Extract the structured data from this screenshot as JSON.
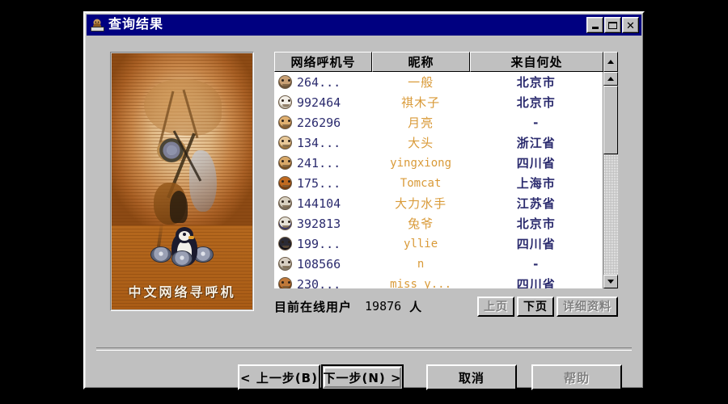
{
  "window": {
    "title": "查询结果",
    "title_icon": "pager-user-icon",
    "buttons": {
      "minimize": "minimize-icon",
      "maximize": "maximize-icon",
      "close": "✕"
    }
  },
  "promo_panel": {
    "caption": "中文网络寻呼机",
    "artwork": "penguin-with-disks-illustration"
  },
  "list": {
    "columns": [
      "网络呼机号",
      "昵称",
      "来自何处"
    ],
    "rows": [
      {
        "avatar": "avatar-face-1",
        "id": "264...",
        "nick": "一般",
        "nick_mono": false,
        "loc": "北京市"
      },
      {
        "avatar": "avatar-face-2",
        "id": "992464",
        "nick": "祺木子",
        "nick_mono": false,
        "loc": "北京市"
      },
      {
        "avatar": "avatar-face-3",
        "id": "226296",
        "nick": "月亮",
        "nick_mono": false,
        "loc": "-"
      },
      {
        "avatar": "avatar-face-4",
        "id": "134...",
        "nick": "大头",
        "nick_mono": false,
        "loc": "浙江省"
      },
      {
        "avatar": "avatar-face-5",
        "id": "241...",
        "nick": "yingxiong",
        "nick_mono": true,
        "loc": "四川省"
      },
      {
        "avatar": "avatar-face-6",
        "id": "175...",
        "nick": "Tomcat",
        "nick_mono": true,
        "loc": "上海市"
      },
      {
        "avatar": "avatar-face-7",
        "id": "144104",
        "nick": "大力水手",
        "nick_mono": false,
        "loc": "江苏省"
      },
      {
        "avatar": "avatar-face-8",
        "id": "392813",
        "nick": "兔爷",
        "nick_mono": false,
        "loc": "北京市"
      },
      {
        "avatar": "avatar-face-9",
        "id": "199...",
        "nick": "yllie",
        "nick_mono": true,
        "loc": "四川省"
      },
      {
        "avatar": "avatar-face-10",
        "id": "108566",
        "nick": "n",
        "nick_mono": true,
        "loc": "-"
      },
      {
        "avatar": "avatar-face-11",
        "id": "230...",
        "nick": "miss y...",
        "nick_mono": true,
        "loc": "四川省"
      }
    ]
  },
  "scrollbar": {
    "up_arrow": "scroll-up-icon",
    "down_arrow": "scroll-down-icon"
  },
  "status": {
    "label": "目前在线用户",
    "count": "19876",
    "unit": "人",
    "prev_page": "上页",
    "next_page": "下页",
    "details": "详细资料"
  },
  "footer": {
    "back": "< 上一步(B)",
    "next": "下一步(N) >",
    "cancel": "取消",
    "help": "帮助"
  },
  "colors": {
    "titlebar": "#000080",
    "face": "#c0c0c0",
    "id_text": "#2b2b6e",
    "nick_text": "#d99a38",
    "loc_text": "#2b2b6e",
    "disabled_text": "#808080",
    "art_orange": "#b5651d"
  }
}
